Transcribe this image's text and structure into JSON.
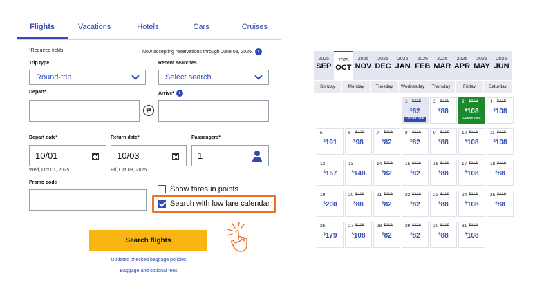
{
  "tabs": [
    {
      "label": "Flights",
      "active": true
    },
    {
      "label": "Vacations"
    },
    {
      "label": "Hotels"
    },
    {
      "label": "Cars"
    },
    {
      "label": "Cruises"
    }
  ],
  "form": {
    "required_note": "*Required fields",
    "reservations_note": "Now accepting reservations through June 03, 2026.",
    "trip_type_label": "Trip type",
    "trip_type_value": "Round-trip",
    "recent_label": "Recent searches",
    "recent_value": "Select search",
    "depart_label": "Depart*",
    "arrive_label": "Arrive*",
    "depart_date_label": "Depart date*",
    "return_date_label": "Return date*",
    "passengers_label": "Passengers*",
    "depart_date_value": "10/01",
    "return_date_value": "10/03",
    "passengers_value": "1",
    "depart_date_sub": "Wed, Oct 01, 2025",
    "return_date_sub": "Fri, Oct 03, 2025",
    "promo_label": "Promo code",
    "show_points_label": "Show fares in points",
    "show_points_checked": false,
    "low_fare_label": "Search with low fare calendar",
    "low_fare_checked": true,
    "search_button": "Search flights",
    "link_baggage_policies": "Updated checked baggage policies",
    "link_baggage_fees": "Baggage and optional fees"
  },
  "calendar": {
    "months": [
      {
        "year": "2025",
        "month": "SEP"
      },
      {
        "year": "2025",
        "month": "OCT",
        "active": true
      },
      {
        "year": "2025",
        "month": "NOV"
      },
      {
        "year": "2025",
        "month": "DEC"
      },
      {
        "year": "2026",
        "month": "JAN"
      },
      {
        "year": "2026",
        "month": "FEB"
      },
      {
        "year": "2026",
        "month": "MAR"
      },
      {
        "year": "2026",
        "month": "APR"
      },
      {
        "year": "2026",
        "month": "MAY"
      },
      {
        "year": "2026",
        "month": "JUN"
      }
    ],
    "weekdays": [
      "Sunday",
      "Monday",
      "Tuesday",
      "Wednesday",
      "Thursday",
      "Friday",
      "Saturday"
    ],
    "depart_tag": "Depart date",
    "return_tag": "Return date",
    "days": [
      {
        "day": "1",
        "old": "$118",
        "price": "82",
        "col": 3,
        "row": 0,
        "state": "depart"
      },
      {
        "day": "2",
        "old": "$119",
        "price": "88",
        "col": 4,
        "row": 0
      },
      {
        "day": "3",
        "old": "$118",
        "price": "108",
        "col": 5,
        "row": 0,
        "state": "return"
      },
      {
        "day": "4",
        "old": "$118",
        "price": "108",
        "col": 6,
        "row": 0
      },
      {
        "day": "5",
        "old": "",
        "price": "191",
        "col": 0,
        "row": 1
      },
      {
        "day": "6",
        "old": "$129",
        "price": "98",
        "col": 1,
        "row": 1
      },
      {
        "day": "7",
        "old": "$118",
        "price": "82",
        "col": 2,
        "row": 1
      },
      {
        "day": "8",
        "old": "$118",
        "price": "82",
        "col": 3,
        "row": 1
      },
      {
        "day": "9",
        "old": "$119",
        "price": "88",
        "col": 4,
        "row": 1
      },
      {
        "day": "10",
        "old": "$118",
        "price": "108",
        "col": 5,
        "row": 1
      },
      {
        "day": "11",
        "old": "$118",
        "price": "108",
        "col": 6,
        "row": 1
      },
      {
        "day": "12",
        "old": "",
        "price": "157",
        "col": 0,
        "row": 2
      },
      {
        "day": "13",
        "old": "",
        "price": "148",
        "col": 1,
        "row": 2
      },
      {
        "day": "14",
        "old": "$118",
        "price": "82",
        "col": 2,
        "row": 2
      },
      {
        "day": "15",
        "old": "$118",
        "price": "82",
        "col": 3,
        "row": 2
      },
      {
        "day": "16",
        "old": "$119",
        "price": "88",
        "col": 4,
        "row": 2
      },
      {
        "day": "17",
        "old": "$118",
        "price": "108",
        "col": 5,
        "row": 2
      },
      {
        "day": "18",
        "old": "$119",
        "price": "88",
        "col": 6,
        "row": 2
      },
      {
        "day": "19",
        "old": "",
        "price": "200",
        "col": 0,
        "row": 3
      },
      {
        "day": "20",
        "old": "$119",
        "price": "88",
        "col": 1,
        "row": 3
      },
      {
        "day": "21",
        "old": "$118",
        "price": "82",
        "col": 2,
        "row": 3
      },
      {
        "day": "22",
        "old": "$118",
        "price": "82",
        "col": 3,
        "row": 3
      },
      {
        "day": "23",
        "old": "$119",
        "price": "88",
        "col": 4,
        "row": 3
      },
      {
        "day": "24",
        "old": "$118",
        "price": "108",
        "col": 5,
        "row": 3
      },
      {
        "day": "25",
        "old": "$119",
        "price": "88",
        "col": 6,
        "row": 3
      },
      {
        "day": "26",
        "old": "",
        "price": "179",
        "col": 0,
        "row": 4
      },
      {
        "day": "27",
        "old": "$118",
        "price": "108",
        "col": 1,
        "row": 4
      },
      {
        "day": "28",
        "old": "$118",
        "price": "82",
        "col": 2,
        "row": 4
      },
      {
        "day": "29",
        "old": "$118",
        "price": "82",
        "col": 3,
        "row": 4
      },
      {
        "day": "30",
        "old": "$119",
        "price": "88",
        "col": 4,
        "row": 4
      },
      {
        "day": "31",
        "old": "$118",
        "price": "108",
        "col": 5,
        "row": 4
      }
    ]
  },
  "colors": {
    "brand_blue": "#304cb2",
    "cta_yellow": "#f9b612",
    "highlight_orange": "#e8732a",
    "return_green": "#1a8a2c"
  }
}
